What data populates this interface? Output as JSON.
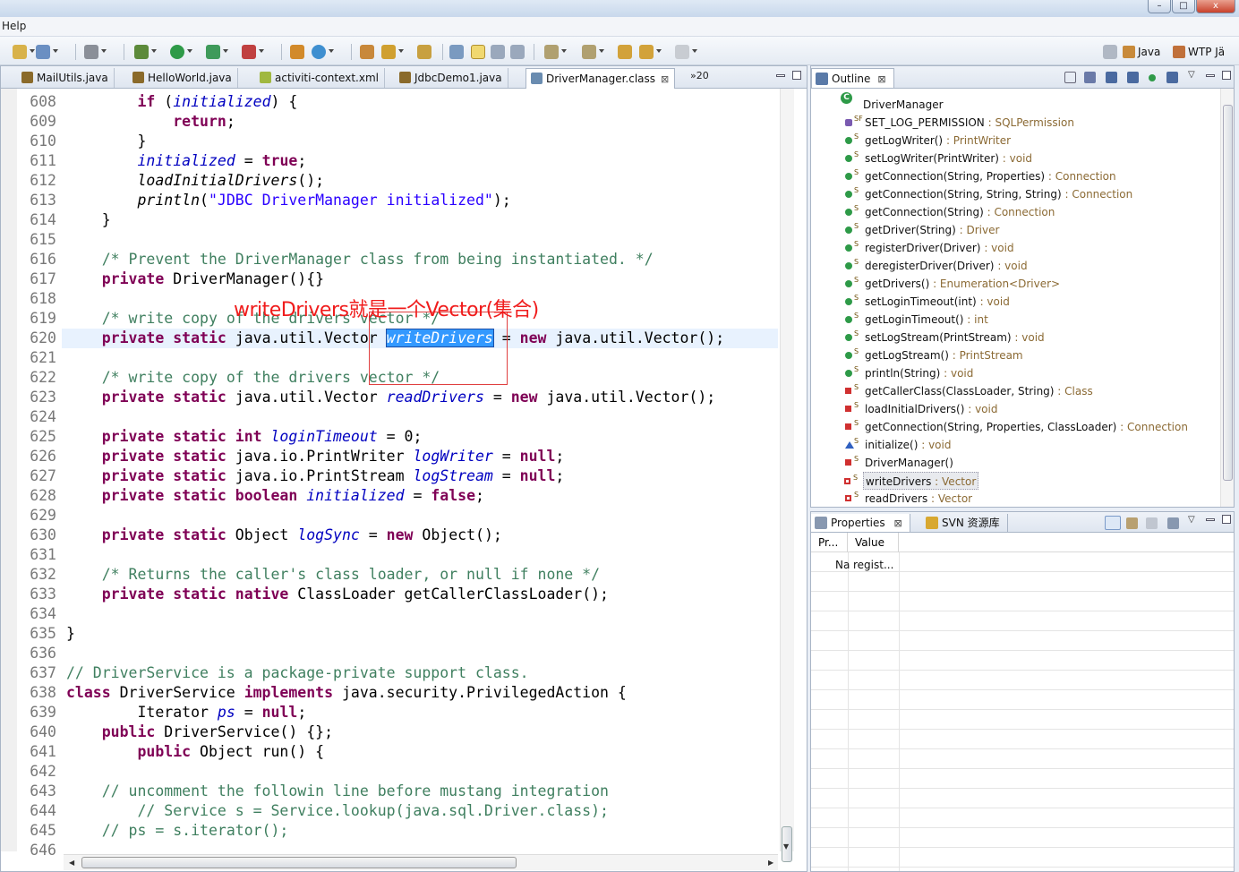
{
  "menu": {
    "help": "Help"
  },
  "window_buttons": {
    "minimize": "–",
    "maximize": "□",
    "close": "x"
  },
  "perspectives": {
    "java": "Java",
    "wtp": "WTP Jä"
  },
  "editor": {
    "tabs": [
      {
        "label": "MailUtils.java",
        "icon": "java-file-icon"
      },
      {
        "label": "HelloWorld.java",
        "icon": "java-file-icon"
      },
      {
        "label": "activiti-context.xml",
        "icon": "xml-file-icon"
      },
      {
        "label": "JdbcDemo1.java",
        "icon": "java-file-icon"
      },
      {
        "label": "DriverManager.class",
        "icon": "class-file-icon",
        "active": true
      }
    ],
    "tab_close": "⊠",
    "more_tabs": "»20",
    "line_numbers": [
      "608",
      "609",
      "610",
      "611",
      "612",
      "613",
      "614",
      "615",
      "616",
      "617",
      "618",
      "619",
      "620",
      "621",
      "622",
      "623",
      "624",
      "625",
      "626",
      "627",
      "628",
      "629",
      "630",
      "631",
      "632",
      "633",
      "634",
      "635",
      "636",
      "637",
      "638",
      "639",
      "640",
      "641",
      "642",
      "643",
      "644",
      "645",
      "646"
    ],
    "current_line": "620",
    "selected_text": "writeDrivers",
    "annotation": "writeDrivers就是一个Vector(集合)"
  },
  "outline": {
    "tab_label": "Outline",
    "root": "DriverManager",
    "items": [
      {
        "name": "SET_LOG_PERMISSION",
        "type": "SQLPermission",
        "icon": "static-final-field-icon",
        "vis": "field"
      },
      {
        "name": "getLogWriter()",
        "type": "PrintWriter",
        "icon": "public-method-icon",
        "vis": "public"
      },
      {
        "name": "setLogWriter(PrintWriter)",
        "type": "void",
        "icon": "public-method-icon",
        "vis": "public"
      },
      {
        "name": "getConnection(String, Properties)",
        "type": "Connection",
        "icon": "public-method-icon",
        "vis": "public"
      },
      {
        "name": "getConnection(String, String, String)",
        "type": "Connection",
        "icon": "public-method-icon",
        "vis": "public"
      },
      {
        "name": "getConnection(String)",
        "type": "Connection",
        "icon": "public-method-icon",
        "vis": "public"
      },
      {
        "name": "getDriver(String)",
        "type": "Driver",
        "icon": "public-method-icon",
        "vis": "public"
      },
      {
        "name": "registerDriver(Driver)",
        "type": "void",
        "icon": "public-sync-method-icon",
        "vis": "public"
      },
      {
        "name": "deregisterDriver(Driver)",
        "type": "void",
        "icon": "public-sync-method-icon",
        "vis": "public"
      },
      {
        "name": "getDrivers()",
        "type": "Enumeration<Driver>",
        "icon": "public-method-icon",
        "vis": "public"
      },
      {
        "name": "setLoginTimeout(int)",
        "type": "void",
        "icon": "public-method-icon",
        "vis": "public"
      },
      {
        "name": "getLoginTimeout()",
        "type": "int",
        "icon": "public-method-icon",
        "vis": "public"
      },
      {
        "name": "setLogStream(PrintStream)",
        "type": "void",
        "icon": "deprecated-method-icon",
        "vis": "public"
      },
      {
        "name": "getLogStream()",
        "type": "PrintStream",
        "icon": "deprecated-method-icon",
        "vis": "public"
      },
      {
        "name": "println(String)",
        "type": "void",
        "icon": "public-method-icon",
        "vis": "public"
      },
      {
        "name": "getCallerClass(ClassLoader, String)",
        "type": "Class",
        "icon": "private-method-icon",
        "vis": "private"
      },
      {
        "name": "loadInitialDrivers()",
        "type": "void",
        "icon": "private-method-icon",
        "vis": "private"
      },
      {
        "name": "getConnection(String, Properties, ClassLoader)",
        "type": "Connection",
        "icon": "private-method-icon",
        "vis": "private"
      },
      {
        "name": "initialize()",
        "type": "void",
        "icon": "default-method-icon",
        "vis": "default"
      },
      {
        "name": "DriverManager()",
        "type": "",
        "icon": "private-constructor-icon",
        "vis": "private"
      },
      {
        "name": "writeDrivers",
        "type": "Vector",
        "icon": "private-field-icon",
        "vis": "privfield",
        "highlighted": true
      },
      {
        "name": "readDrivers",
        "type": "Vector",
        "icon": "private-field-icon",
        "vis": "privfield"
      }
    ]
  },
  "properties": {
    "tab_label": "Properties",
    "svn_tab_label": "SVN 资源库",
    "columns": [
      "Pr...",
      "Value"
    ],
    "row": {
      "property": "Na",
      "value": "regist..."
    }
  },
  "colors": {
    "keyword": "#7f0055",
    "field": "#0000c0",
    "string": "#2a00ff",
    "comment": "#3f7f5f",
    "annotation": "#f01c1c",
    "selection": "#3399ff"
  }
}
